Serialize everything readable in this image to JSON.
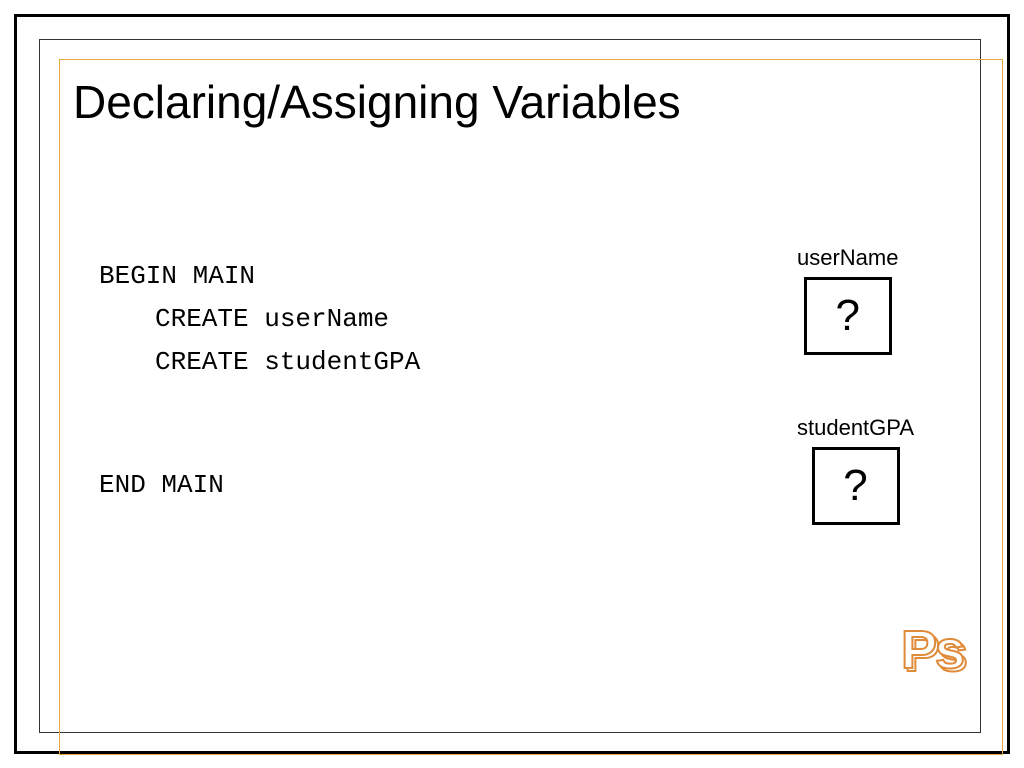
{
  "title": "Declaring/Assigning Variables",
  "code": {
    "line1": "BEGIN MAIN",
    "line2": "CREATE userName",
    "line3": "CREATE studentGPA",
    "line4": "END MAIN"
  },
  "variables": [
    {
      "label": "userName",
      "value": "?"
    },
    {
      "label": "studentGPA",
      "value": "?"
    }
  ],
  "logo": "Ps"
}
